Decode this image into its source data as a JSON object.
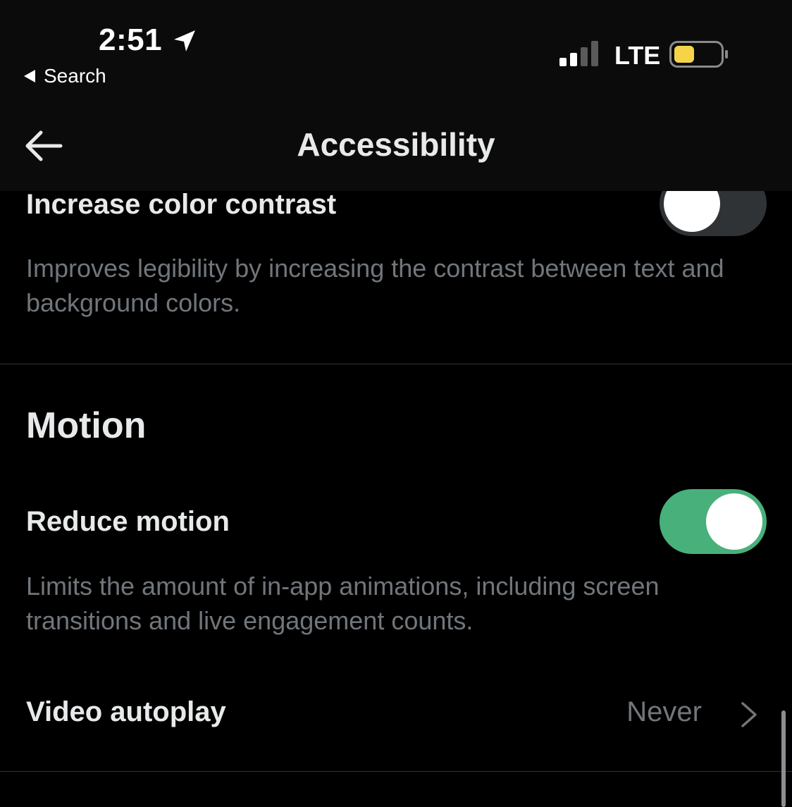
{
  "status_bar": {
    "time": "2:51",
    "back_app_label": "Search",
    "network": "LTE",
    "battery_color": "#f5d547",
    "icons": [
      "location-arrow-icon",
      "signal-bars-icon",
      "battery-icon"
    ]
  },
  "header": {
    "title": "Accessibility",
    "back_icon": "arrow-left-icon"
  },
  "settings": {
    "increase_contrast": {
      "title": "Increase color contrast",
      "description": "Improves legibility by increasing the contrast between text and background colors.",
      "enabled": false
    },
    "motion_section": {
      "heading": "Motion"
    },
    "reduce_motion": {
      "title": "Reduce motion",
      "description": "Limits the amount of in-app animations, including screen transitions and live engagement counts.",
      "enabled": true
    },
    "video_autoplay": {
      "title": "Video autoplay",
      "value": "Never",
      "icon": "chevron-right-icon"
    }
  },
  "colors": {
    "background": "#000000",
    "header_background": "#0b0b0b",
    "primary_text": "#e7e9ea",
    "secondary_text": "#71767b",
    "toggle_on": "#48b07a",
    "toggle_off": "#2f3336",
    "divider": "#2f3336"
  }
}
